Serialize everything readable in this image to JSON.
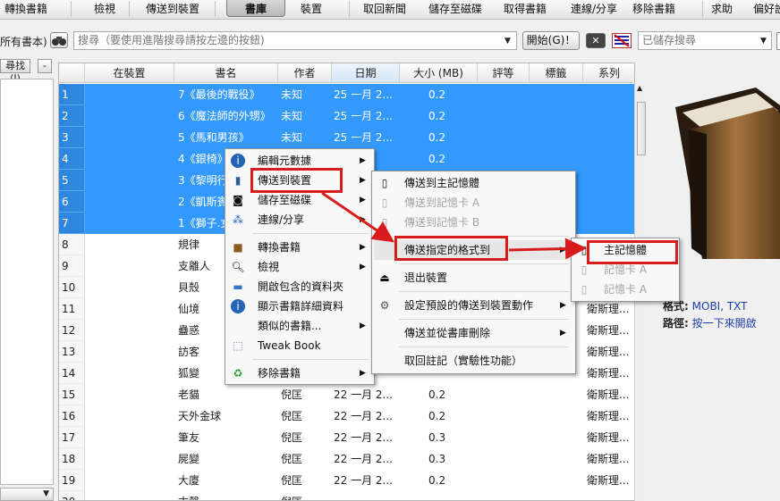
{
  "toolbar": {
    "items": [
      "轉換書籍",
      "檢視",
      "傳送到裝置",
      "書庫",
      "裝置",
      "取回新聞",
      "儲存至磁碟",
      "取得書籍",
      "連線/分享",
      "移除書籍",
      "求助",
      "偏好設"
    ],
    "active": "書庫"
  },
  "search": {
    "left_label": "所有書本)",
    "placeholder": "搜尋（要使用進階搜尋請按左邊的按鈕)",
    "go_label": "開始(G)！",
    "saved_placeholder": "已儲存搜尋"
  },
  "left": {
    "find_label": "尋找(I)",
    "collapse_label": "-"
  },
  "table": {
    "headers": [
      "在裝置",
      "書名",
      "作者",
      "日期",
      "大小 (MB)",
      "評等",
      "標籤",
      "系列"
    ],
    "rows": [
      {
        "n": "1",
        "title": "7《最後的戰役》",
        "author": "未知",
        "date": "25 一月 2...",
        "size": "0.2",
        "series": ""
      },
      {
        "n": "2",
        "title": "6《魔法師的外甥》",
        "author": "未知",
        "date": "25 一月 2...",
        "size": "0.2",
        "series": ""
      },
      {
        "n": "3",
        "title": "5《馬和男孩》",
        "author": "未知",
        "date": "25 一月 2...",
        "size": "0.2",
        "series": ""
      },
      {
        "n": "4",
        "title": "4《銀椅》",
        "author": "",
        "date": "",
        "size": "0.2",
        "series": ""
      },
      {
        "n": "5",
        "title": "3《黎明行",
        "author": "",
        "date": "",
        "size": "",
        "series": ""
      },
      {
        "n": "6",
        "title": "2《凱斯賓",
        "author": "",
        "date": "",
        "size": "",
        "series": ""
      },
      {
        "n": "7",
        "title": "1《獅子.女",
        "author": "",
        "date": "",
        "size": "",
        "series": ""
      },
      {
        "n": "8",
        "title": "規律",
        "author": "",
        "date": "",
        "size": "",
        "series": ""
      },
      {
        "n": "9",
        "title": "支離人",
        "author": "",
        "date": "",
        "size": "",
        "series": ""
      },
      {
        "n": "10",
        "title": "貝殼",
        "author": "",
        "date": "",
        "size": "",
        "series": ""
      },
      {
        "n": "11",
        "title": "仙境",
        "author": "",
        "date": "",
        "size": "",
        "series": "衛斯理..."
      },
      {
        "n": "12",
        "title": "蠱惑",
        "author": "",
        "date": "",
        "size": "",
        "series": "衛斯理..."
      },
      {
        "n": "13",
        "title": "訪客",
        "author": "",
        "date": "",
        "size": "",
        "series": "衛斯理..."
      },
      {
        "n": "14",
        "title": "狐變",
        "author": "",
        "date": "",
        "size": "",
        "series": "衛斯理..."
      },
      {
        "n": "15",
        "title": "老貓",
        "author": "倪匡",
        "date": "22 一月 2...",
        "size": "0.2",
        "series": "衛斯理..."
      },
      {
        "n": "16",
        "title": "天外金球",
        "author": "倪匡",
        "date": "22 一月 2...",
        "size": "0.2",
        "series": "衛斯理..."
      },
      {
        "n": "17",
        "title": "筆友",
        "author": "倪匡",
        "date": "22 一月 2...",
        "size": "0.3",
        "series": "衛斯理..."
      },
      {
        "n": "18",
        "title": "屍變",
        "author": "倪匡",
        "date": "22 一月 2...",
        "size": "0.3",
        "series": "衛斯理..."
      },
      {
        "n": "19",
        "title": "大廈",
        "author": "倪匡",
        "date": "22 一月 2...",
        "size": "0.2",
        "series": "衛斯理..."
      },
      {
        "n": "20",
        "title": "古聲",
        "author": "倪匡",
        "date": "",
        "size": "",
        "series": ""
      }
    ]
  },
  "details": {
    "format_label": "格式:",
    "format_value": "MOBI, TXT",
    "path_label": "路徑:",
    "path_value": "按一下來開啟"
  },
  "context_menu": {
    "items": [
      "編輯元數據",
      "傳送到裝置",
      "儲存至磁碟",
      "連線/分享",
      "轉換書籍",
      "檢視",
      "開啟包含的資料夾",
      "顯示書籍詳細資料",
      "類似的書籍...",
      "Tweak Book",
      "移除書籍"
    ]
  },
  "device_menu": {
    "items": [
      "傳送到主記憶體",
      "傳送到記憶卡 A",
      "傳送到記憶卡 B",
      "傳送指定的格式到",
      "退出裝置",
      "設定預設的傳送到裝置動作",
      "傳送並從書庫刪除",
      "取回註記（實驗性功能）"
    ]
  },
  "format_menu": {
    "items": [
      "主記憶體",
      "記憶卡 A",
      "記憶卡 A"
    ]
  },
  "colors": {
    "selection": "#3399ff",
    "highlight": "#d81c1c",
    "link": "#1a3ea8"
  }
}
